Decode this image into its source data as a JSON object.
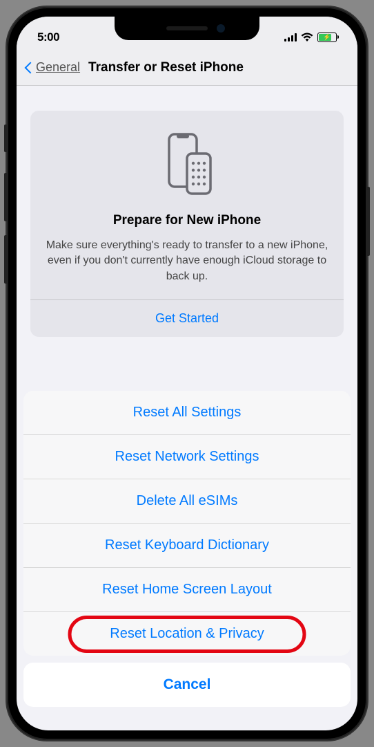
{
  "status_bar": {
    "time": "5:00"
  },
  "nav": {
    "back_label": "General",
    "title": "Transfer or Reset iPhone"
  },
  "prepare_card": {
    "title": "Prepare for New iPhone",
    "description": "Make sure everything's ready to transfer to a new iPhone, even if you don't currently have enough iCloud storage to back up.",
    "action_label": "Get Started"
  },
  "action_sheet": {
    "items": [
      "Reset All Settings",
      "Reset Network Settings",
      "Delete All eSIMs",
      "Reset Keyboard Dictionary",
      "Reset Home Screen Layout",
      "Reset Location & Privacy"
    ],
    "cancel_label": "Cancel",
    "highlighted_index": 5
  }
}
